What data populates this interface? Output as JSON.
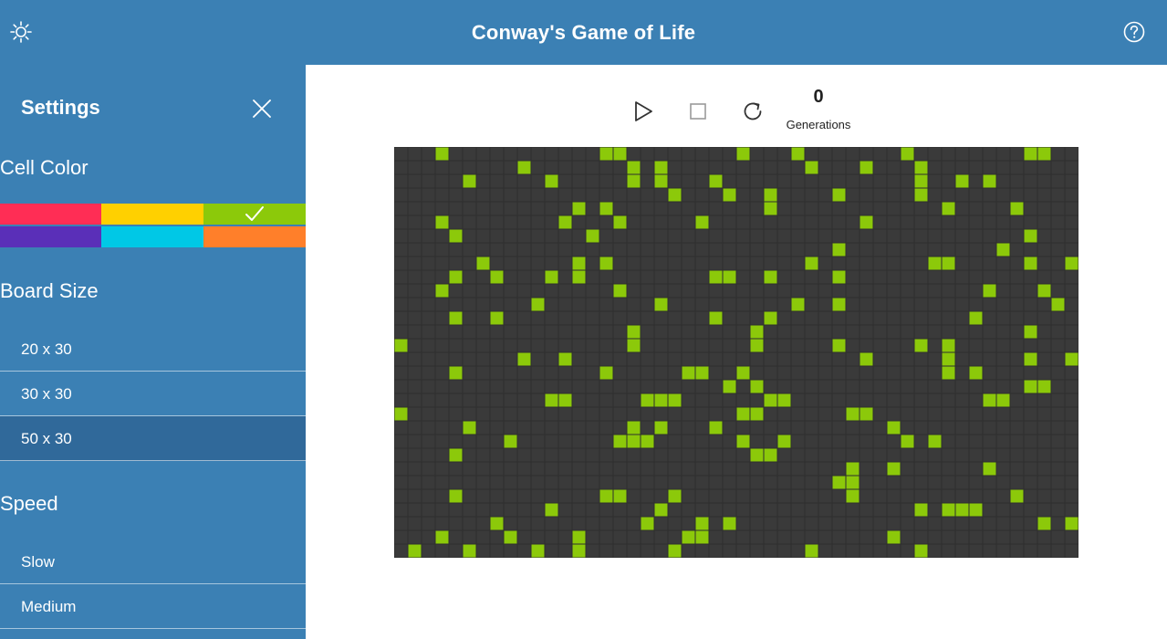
{
  "header": {
    "title": "Conway's Game of Life",
    "settings_icon": "sun-gear-icon",
    "help_icon": "help-circle-icon"
  },
  "settings": {
    "title": "Settings",
    "close_icon": "close-icon",
    "cell_color": {
      "label": "Cell Color",
      "swatches": [
        {
          "color": "#ff2d55",
          "selected": false
        },
        {
          "color": "#ffd000",
          "selected": false
        },
        {
          "color": "#8cc90a",
          "selected": true
        },
        {
          "color": "#5a2fb8",
          "selected": false
        },
        {
          "color": "#00c8e6",
          "selected": false
        },
        {
          "color": "#ff7f2a",
          "selected": false
        }
      ]
    },
    "board_size": {
      "label": "Board Size",
      "options": [
        {
          "label": "20 x 30",
          "selected": false
        },
        {
          "label": "30 x 30",
          "selected": false
        },
        {
          "label": "50 x 30",
          "selected": true
        }
      ]
    },
    "speed": {
      "label": "Speed",
      "options": [
        {
          "label": "Slow",
          "selected": false
        },
        {
          "label": "Medium",
          "selected": false
        }
      ]
    }
  },
  "controls": {
    "play_icon": "play-icon",
    "stop_icon": "stop-icon",
    "reset_icon": "reset-icon",
    "generations_value": "0",
    "generations_label": "Generations"
  },
  "board": {
    "cols": 50,
    "rows": 30,
    "cell_color": "#8cc90a",
    "dead_color": "#3a3a3a",
    "grid_line_color": "#2e2e2e",
    "live_cells": [
      [
        3,
        0
      ],
      [
        15,
        0
      ],
      [
        16,
        0
      ],
      [
        25,
        0
      ],
      [
        29,
        0
      ],
      [
        37,
        0
      ],
      [
        46,
        0
      ],
      [
        47,
        0
      ],
      [
        9,
        1
      ],
      [
        17,
        1
      ],
      [
        19,
        1
      ],
      [
        30,
        1
      ],
      [
        34,
        1
      ],
      [
        38,
        1
      ],
      [
        5,
        2
      ],
      [
        11,
        2
      ],
      [
        17,
        2
      ],
      [
        19,
        2
      ],
      [
        23,
        2
      ],
      [
        38,
        2
      ],
      [
        41,
        2
      ],
      [
        43,
        2
      ],
      [
        20,
        3
      ],
      [
        24,
        3
      ],
      [
        27,
        3
      ],
      [
        32,
        3
      ],
      [
        38,
        3
      ],
      [
        13,
        4
      ],
      [
        15,
        4
      ],
      [
        27,
        4
      ],
      [
        40,
        4
      ],
      [
        45,
        4
      ],
      [
        3,
        5
      ],
      [
        12,
        5
      ],
      [
        16,
        5
      ],
      [
        22,
        5
      ],
      [
        34,
        5
      ],
      [
        4,
        6
      ],
      [
        14,
        6
      ],
      [
        46,
        6
      ],
      [
        32,
        7
      ],
      [
        44,
        7
      ],
      [
        6,
        8
      ],
      [
        13,
        8
      ],
      [
        15,
        8
      ],
      [
        30,
        8
      ],
      [
        39,
        8
      ],
      [
        40,
        8
      ],
      [
        46,
        8
      ],
      [
        49,
        8
      ],
      [
        4,
        9
      ],
      [
        7,
        9
      ],
      [
        11,
        9
      ],
      [
        13,
        9
      ],
      [
        23,
        9
      ],
      [
        24,
        9
      ],
      [
        27,
        9
      ],
      [
        32,
        9
      ],
      [
        3,
        10
      ],
      [
        16,
        10
      ],
      [
        43,
        10
      ],
      [
        47,
        10
      ],
      [
        10,
        11
      ],
      [
        19,
        11
      ],
      [
        29,
        11
      ],
      [
        32,
        11
      ],
      [
        48,
        11
      ],
      [
        4,
        12
      ],
      [
        7,
        12
      ],
      [
        23,
        12
      ],
      [
        27,
        12
      ],
      [
        42,
        12
      ],
      [
        17,
        13
      ],
      [
        26,
        13
      ],
      [
        46,
        13
      ],
      [
        0,
        14
      ],
      [
        17,
        14
      ],
      [
        26,
        14
      ],
      [
        32,
        14
      ],
      [
        38,
        14
      ],
      [
        40,
        14
      ],
      [
        9,
        15
      ],
      [
        12,
        15
      ],
      [
        34,
        15
      ],
      [
        40,
        15
      ],
      [
        46,
        15
      ],
      [
        49,
        15
      ],
      [
        4,
        16
      ],
      [
        15,
        16
      ],
      [
        21,
        16
      ],
      [
        22,
        16
      ],
      [
        25,
        16
      ],
      [
        40,
        16
      ],
      [
        42,
        16
      ],
      [
        24,
        17
      ],
      [
        26,
        17
      ],
      [
        46,
        17
      ],
      [
        47,
        17
      ],
      [
        11,
        18
      ],
      [
        12,
        18
      ],
      [
        18,
        18
      ],
      [
        19,
        18
      ],
      [
        20,
        18
      ],
      [
        27,
        18
      ],
      [
        28,
        18
      ],
      [
        43,
        18
      ],
      [
        44,
        18
      ],
      [
        0,
        19
      ],
      [
        25,
        19
      ],
      [
        26,
        19
      ],
      [
        33,
        19
      ],
      [
        34,
        19
      ],
      [
        5,
        20
      ],
      [
        17,
        20
      ],
      [
        19,
        20
      ],
      [
        23,
        20
      ],
      [
        36,
        20
      ],
      [
        8,
        21
      ],
      [
        16,
        21
      ],
      [
        17,
        21
      ],
      [
        18,
        21
      ],
      [
        25,
        21
      ],
      [
        28,
        21
      ],
      [
        37,
        21
      ],
      [
        39,
        21
      ],
      [
        4,
        22
      ],
      [
        26,
        22
      ],
      [
        27,
        22
      ],
      [
        33,
        23
      ],
      [
        36,
        23
      ],
      [
        43,
        23
      ],
      [
        32,
        24
      ],
      [
        33,
        24
      ],
      [
        4,
        25
      ],
      [
        15,
        25
      ],
      [
        16,
        25
      ],
      [
        20,
        25
      ],
      [
        33,
        25
      ],
      [
        45,
        25
      ],
      [
        11,
        26
      ],
      [
        19,
        26
      ],
      [
        38,
        26
      ],
      [
        40,
        26
      ],
      [
        41,
        26
      ],
      [
        42,
        26
      ],
      [
        7,
        27
      ],
      [
        18,
        27
      ],
      [
        22,
        27
      ],
      [
        24,
        27
      ],
      [
        47,
        27
      ],
      [
        49,
        27
      ],
      [
        3,
        28
      ],
      [
        8,
        28
      ],
      [
        13,
        28
      ],
      [
        21,
        28
      ],
      [
        22,
        28
      ],
      [
        36,
        28
      ],
      [
        1,
        29
      ],
      [
        5,
        29
      ],
      [
        10,
        29
      ],
      [
        13,
        29
      ],
      [
        20,
        29
      ],
      [
        30,
        29
      ],
      [
        38,
        29
      ]
    ]
  }
}
